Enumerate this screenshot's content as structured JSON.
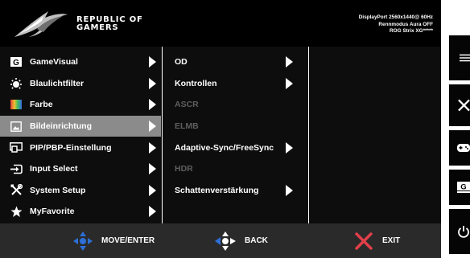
{
  "header": {
    "brand_line1": "REPUBLIC OF",
    "brand_line2": "GAMERS",
    "info_line1": "DisplayPort 2560x1440@ 60Hz",
    "info_line2": "Rennmodus Aura OFF",
    "info_line3": "ROG Strix XG*****"
  },
  "main_menu": {
    "items": [
      {
        "label": "GameVisual",
        "icon": "gamevisual-icon",
        "selected": false
      },
      {
        "label": "Blaulichtfilter",
        "icon": "bluelight-icon",
        "selected": false
      },
      {
        "label": "Farbe",
        "icon": "color-icon",
        "selected": false
      },
      {
        "label": "Bildeinrichtung",
        "icon": "image-icon",
        "selected": true
      },
      {
        "label": "PIP/PBP-Einstellung",
        "icon": "pip-icon",
        "selected": false
      },
      {
        "label": "Input Select",
        "icon": "input-icon",
        "selected": false
      },
      {
        "label": "System Setup",
        "icon": "tools-icon",
        "selected": false
      },
      {
        "label": "MyFavorite",
        "icon": "star-icon",
        "selected": false
      }
    ]
  },
  "sub_menu": {
    "items": [
      {
        "label": "OD",
        "enabled": true,
        "has_arrow": true
      },
      {
        "label": "Kontrollen",
        "enabled": true,
        "has_arrow": true
      },
      {
        "label": "ASCR",
        "enabled": false,
        "has_arrow": false
      },
      {
        "label": "ELMB",
        "enabled": false,
        "has_arrow": false
      },
      {
        "label": "Adaptive-Sync/FreeSync",
        "enabled": true,
        "has_arrow": true
      },
      {
        "label": "HDR",
        "enabled": false,
        "has_arrow": false
      },
      {
        "label": "Schattenverstärkung",
        "enabled": true,
        "has_arrow": true
      }
    ]
  },
  "footer": {
    "move_label": "MOVE/ENTER",
    "back_label": "BACK",
    "exit_label": "EXIT"
  },
  "side_buttons": [
    {
      "icon": "menu-icon"
    },
    {
      "icon": "close-icon"
    },
    {
      "icon": "gamepad-icon"
    },
    {
      "icon": "gamevisual-hotkey-icon"
    },
    {
      "icon": "power-icon"
    }
  ],
  "colors": {
    "selected_bg": "#8b8b8b",
    "disabled_text": "#5e5e5e",
    "nav_blue": "#2d6fd6",
    "exit_red": "#e2404a"
  }
}
